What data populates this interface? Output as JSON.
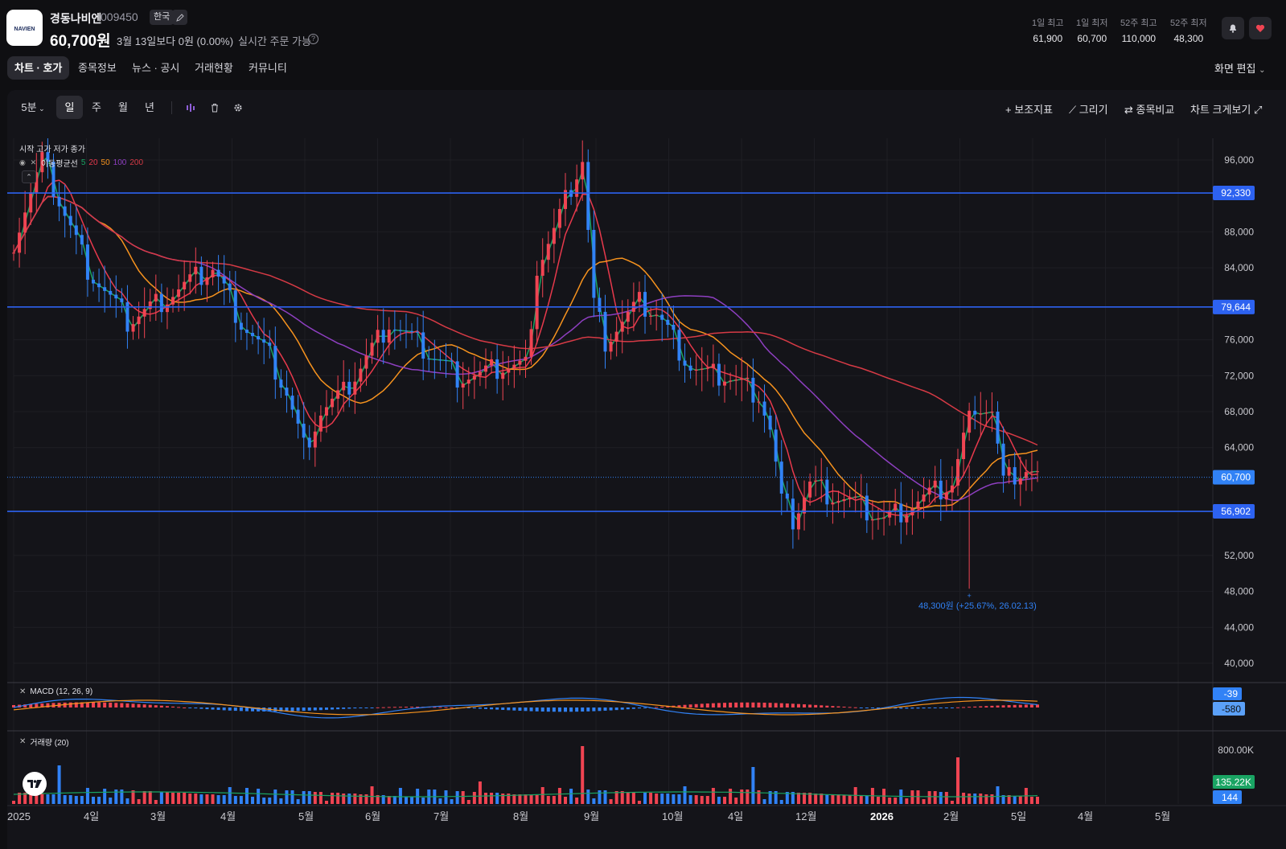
{
  "header": {
    "logo_text": "NAVIEN",
    "stock_name": "경동나비엔",
    "stock_code": "009450",
    "market_badge": "한국",
    "price": "60,700원",
    "change_text": "3월 13일보다 0원 (0.00%)",
    "realtime_label": "실시간 주문 가능",
    "help_glyph": "?",
    "stats": [
      {
        "label": "1일 최고",
        "value": "61,900"
      },
      {
        "label": "1일 최저",
        "value": "60,700"
      },
      {
        "label": "52주 최고",
        "value": "110,000"
      },
      {
        "label": "52주 최저",
        "value": "48,300"
      }
    ]
  },
  "tabs": [
    {
      "label": "차트 · 호가",
      "active": true
    },
    {
      "label": "종목정보",
      "active": false
    },
    {
      "label": "뉴스 · 공시",
      "active": false
    },
    {
      "label": "거래현황",
      "active": false
    },
    {
      "label": "커뮤니티",
      "active": false
    }
  ],
  "screen_edit_label": "화면 편집",
  "toolbar": {
    "interval": "5분",
    "periods": [
      "일",
      "주",
      "월",
      "년"
    ],
    "active_period": "일",
    "indicator_label": "+ 보조지표",
    "draw_label": "그리기",
    "compare_label": "종목비교",
    "fullscreen_label": "차트 크게보기"
  },
  "chart_legend": {
    "ohlc_label": "시작 고가 저가 종가",
    "ma_label": "이동평균선",
    "ma_periods": [
      "5",
      "20",
      "50",
      "100",
      "200"
    ],
    "macd_label": "MACD (12, 26, 9)",
    "volume_label": "거래량 (20)"
  },
  "chart_data": {
    "type": "candlestick",
    "y_axis": {
      "ticks": [
        "96,000",
        "88,000",
        "84,000",
        "76,000",
        "72,000",
        "68,000",
        "64,000",
        "52,000",
        "48,000",
        "44,000",
        "40,000"
      ],
      "ylim": [
        38000,
        98000
      ]
    },
    "x_axis": {
      "ticks": [
        "2025",
        "4일",
        "3월",
        "4월",
        "5월",
        "6월",
        "7월",
        "8월",
        "9월",
        "10월",
        "4일",
        "12월",
        "2026",
        "2월",
        "5일",
        "4월",
        "5월"
      ]
    },
    "horizontal_lines": [
      {
        "value": 92330,
        "label": "92,330"
      },
      {
        "value": 79644,
        "label": "79,644"
      },
      {
        "value": 56902,
        "label": "56,902"
      }
    ],
    "last_price": {
      "value": 60700,
      "label": "60,700"
    },
    "low_annotation": "48,300원 (+25.67%, 26.02.13)",
    "macd_axis_labels": [
      "-39",
      "-580"
    ],
    "volume_axis": {
      "ticks": [
        "800.00K"
      ],
      "current": "135.22K",
      "ma": "144"
    },
    "series_colors": {
      "up": "#f04452",
      "down": "#3182f6",
      "ma5": "#19a463",
      "ma20": "#e8394c",
      "ma50": "#f7931e",
      "ma100": "#8e3fc1",
      "ma200": "#d63a45",
      "level": "#2d62f0"
    },
    "close_path": [
      [
        0,
        87000
      ],
      [
        5,
        96000
      ],
      [
        13,
        84000
      ],
      [
        20,
        78000
      ],
      [
        25,
        80000
      ],
      [
        30,
        82000
      ],
      [
        35,
        84000
      ],
      [
        40,
        78000
      ],
      [
        45,
        74000
      ],
      [
        48,
        70000
      ],
      [
        51,
        64000
      ],
      [
        54,
        68000
      ],
      [
        58,
        70000
      ],
      [
        62,
        74000
      ],
      [
        66,
        78000
      ],
      [
        70,
        76000
      ],
      [
        74,
        74000
      ],
      [
        78,
        72000
      ],
      [
        82,
        72000
      ],
      [
        86,
        73000
      ],
      [
        90,
        73000
      ],
      [
        92,
        84000
      ],
      [
        95,
        88000
      ],
      [
        98,
        93000
      ],
      [
        100,
        96000
      ],
      [
        102,
        80000
      ],
      [
        104,
        76000
      ],
      [
        107,
        78000
      ],
      [
        110,
        80000
      ],
      [
        113,
        79000
      ],
      [
        116,
        76000
      ],
      [
        119,
        73000
      ],
      [
        122,
        72000
      ],
      [
        125,
        72000
      ],
      [
        128,
        71000
      ],
      [
        131,
        70000
      ],
      [
        133,
        66000
      ],
      [
        135,
        58000
      ],
      [
        137,
        56000
      ],
      [
        140,
        60000
      ],
      [
        143,
        59000
      ],
      [
        147,
        58000
      ],
      [
        150,
        57000
      ],
      [
        153,
        56000
      ],
      [
        156,
        57000
      ],
      [
        159,
        58000
      ],
      [
        162,
        59000
      ],
      [
        165,
        60000
      ],
      [
        167,
        65000
      ],
      [
        169,
        69000
      ],
      [
        172,
        68000
      ],
      [
        174,
        60000
      ],
      [
        176,
        61000
      ],
      [
        178,
        61500
      ],
      [
        180,
        60700
      ]
    ]
  }
}
